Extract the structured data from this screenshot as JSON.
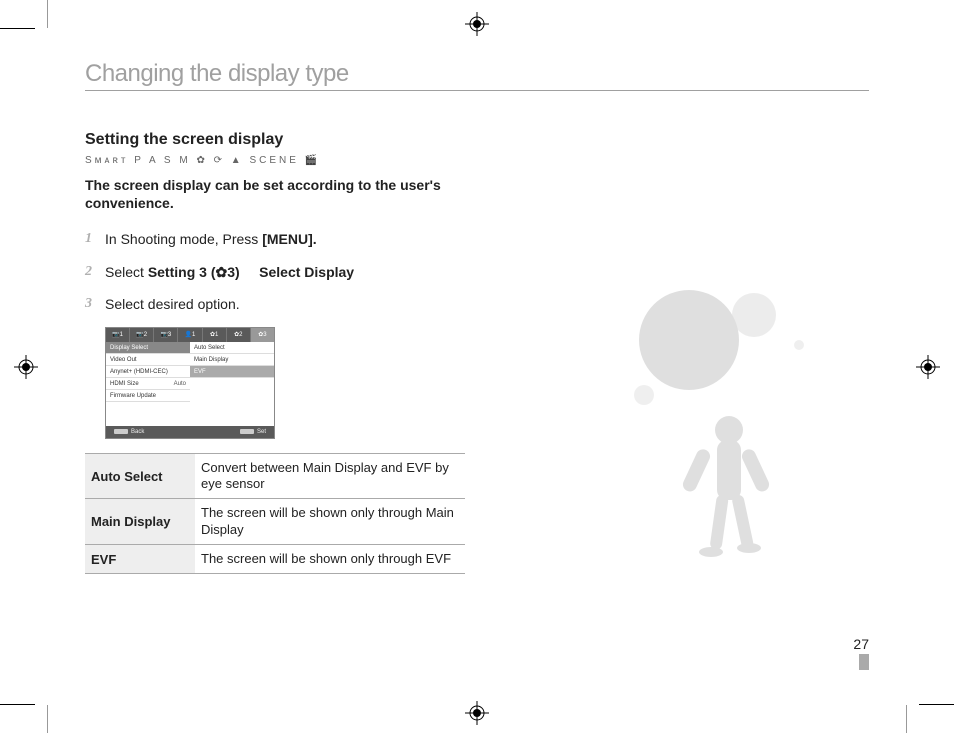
{
  "title": "Changing the display type",
  "heading": "Setting the screen display",
  "mode_icons": "Sᴍᴀʀᴛ  P  A  S  M  ✿  ⟳  ▲  SCENE  🎬",
  "intro": "The screen display can be set according to the user's convenience.",
  "steps": {
    "s1": {
      "num": "1",
      "pre": "In Shooting mode, Press ",
      "bold": "[MENU].",
      "post": ""
    },
    "s2": {
      "num": "2",
      "pre": "Select ",
      "bold1": "Setting 3 (",
      "icon": "✿3",
      "bold2": ")",
      "gap": " → ",
      "bold3": "Select Display"
    },
    "s3": {
      "num": "3",
      "text": "Select desired option."
    }
  },
  "menu": {
    "tabs": [
      "📷1",
      "📷2",
      "📷3",
      "👤1",
      "✿1",
      "✿2",
      "✿3"
    ],
    "left": [
      {
        "label": "Display Select",
        "sel": true
      },
      {
        "label": "Video Out"
      },
      {
        "label": "Anynet+ (HDMI-CEC)"
      },
      {
        "label": "HDMI Size",
        "val": "Auto"
      },
      {
        "label": "Firmware Update"
      }
    ],
    "right": [
      {
        "label": "Auto Select"
      },
      {
        "label": "Main Display"
      },
      {
        "label": "EVF",
        "sel": true
      }
    ],
    "footer": {
      "back": "Back",
      "set": "Set"
    }
  },
  "options": [
    {
      "name": "Auto Select",
      "desc": "Convert between Main Display and EVF by eye sensor"
    },
    {
      "name": "Main Display",
      "desc": "The screen will be shown only through Main Display"
    },
    {
      "name": "EVF",
      "desc": "The screen will be shown only through EVF"
    }
  ],
  "page_number": "27"
}
